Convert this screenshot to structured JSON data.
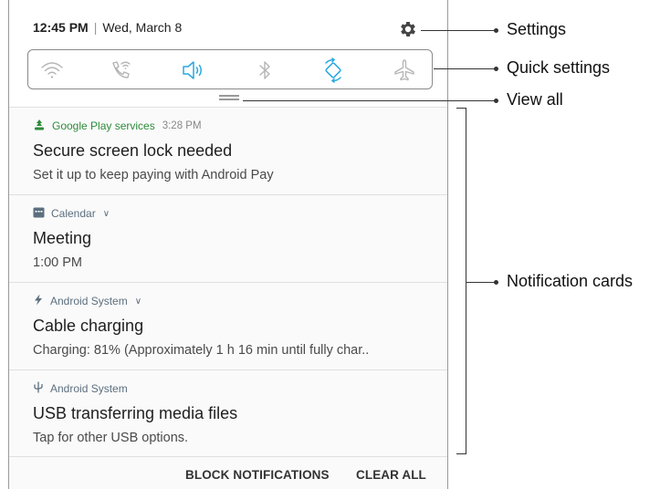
{
  "status_bar": {
    "time": "12:45 PM",
    "separator": "|",
    "date": "Wed, March 8"
  },
  "settings_icon": "gear-icon",
  "quick_settings": [
    {
      "icon": "wifi-icon",
      "active": false
    },
    {
      "icon": "wifi-calling-icon",
      "active": false
    },
    {
      "icon": "sound-icon",
      "active": true
    },
    {
      "icon": "bluetooth-icon",
      "active": false
    },
    {
      "icon": "auto-rotate-icon",
      "active": true
    },
    {
      "icon": "airplane-mode-icon",
      "active": false
    }
  ],
  "notifications": [
    {
      "app": "Google Play services",
      "time": "3:28 PM",
      "title": "Secure screen lock needed",
      "body": "Set it up to keep paying with Android Pay",
      "icon": "android-pay-icon"
    },
    {
      "app": "Calendar",
      "title": "Meeting",
      "body": "1:00 PM",
      "icon": "calendar-icon",
      "expandable": true
    },
    {
      "app": "Android System",
      "title": "Cable charging",
      "body": "Charging: 81% (Approximately 1 h 16 min until fully char..",
      "icon": "bolt-icon",
      "expandable": true
    },
    {
      "app": "Android System",
      "title": "USB transferring media files",
      "body": "Tap for other USB options.",
      "icon": "usb-icon"
    }
  ],
  "actions": {
    "block": "BLOCK NOTIFICATIONS",
    "clear": "CLEAR ALL"
  },
  "callouts": {
    "settings": "Settings",
    "quick_settings": "Quick settings",
    "view_all": "View all",
    "notification_cards": "Notification cards"
  },
  "colors": {
    "active_icon": "#29a9e0",
    "inactive_icon": "#b5b5b5",
    "google_play_green": "#2e8b3a",
    "meta_text": "#5b6f7e"
  }
}
